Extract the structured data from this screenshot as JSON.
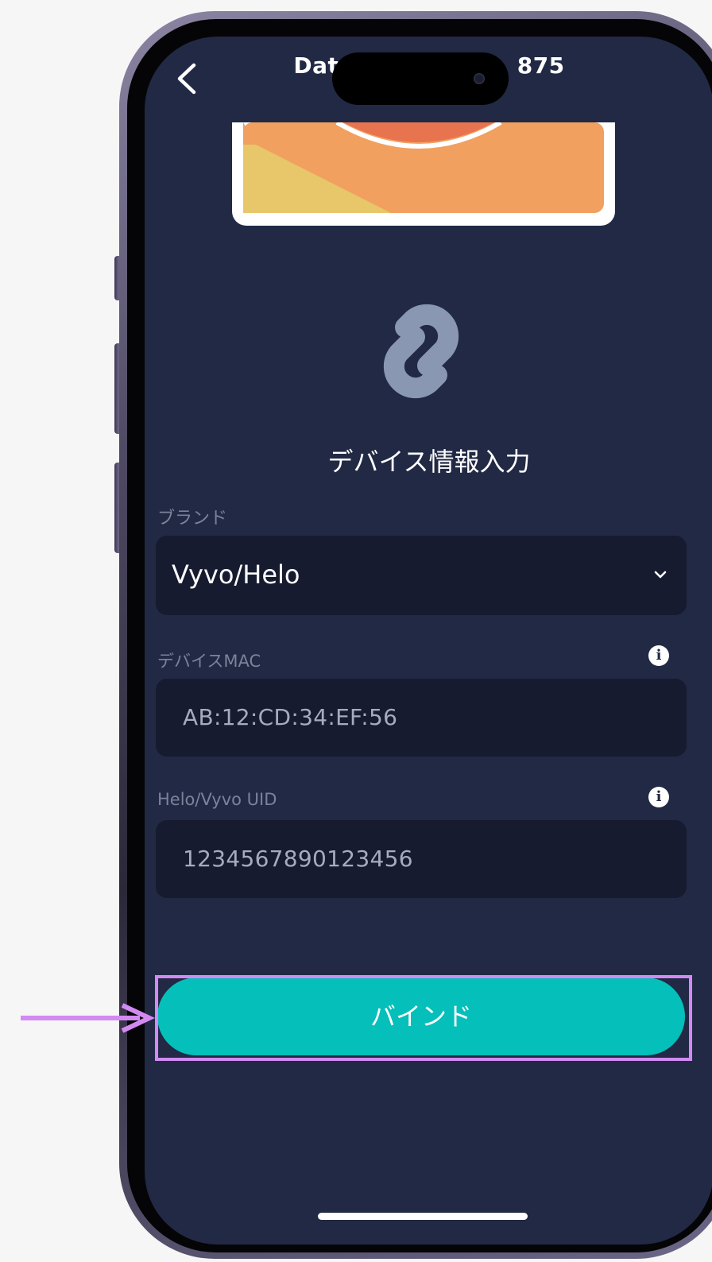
{
  "header": {
    "title": "Data                    875",
    "back_icon": "chevron-left-icon"
  },
  "illustration": {
    "colors": {
      "orange": "#f1a060",
      "yellow": "#e8c66a",
      "red": "#e8744f"
    }
  },
  "link_icon": {
    "name": "link-chain-icon",
    "color": "#8a97b2"
  },
  "form": {
    "title": "デバイス情報入力",
    "brand": {
      "label": "ブランド",
      "value": "Vyvo/Helo",
      "icon": "chevron-down-icon"
    },
    "mac": {
      "label": "デバイスMAC",
      "placeholder": "AB:12:CD:34:EF:56",
      "icon": "info-icon"
    },
    "uid": {
      "label": "Helo/Vyvo UID",
      "placeholder": "1234567890123456",
      "icon": "info-icon"
    }
  },
  "bind_button": {
    "label": "バインド",
    "color": "#05bfba"
  },
  "annotation": {
    "highlight_color": "#d28af2",
    "pointer": "arrow-right-icon"
  },
  "theme": {
    "screen_bg": "#212945",
    "field_bg": "#171b30",
    "accent": "#05bfba"
  }
}
